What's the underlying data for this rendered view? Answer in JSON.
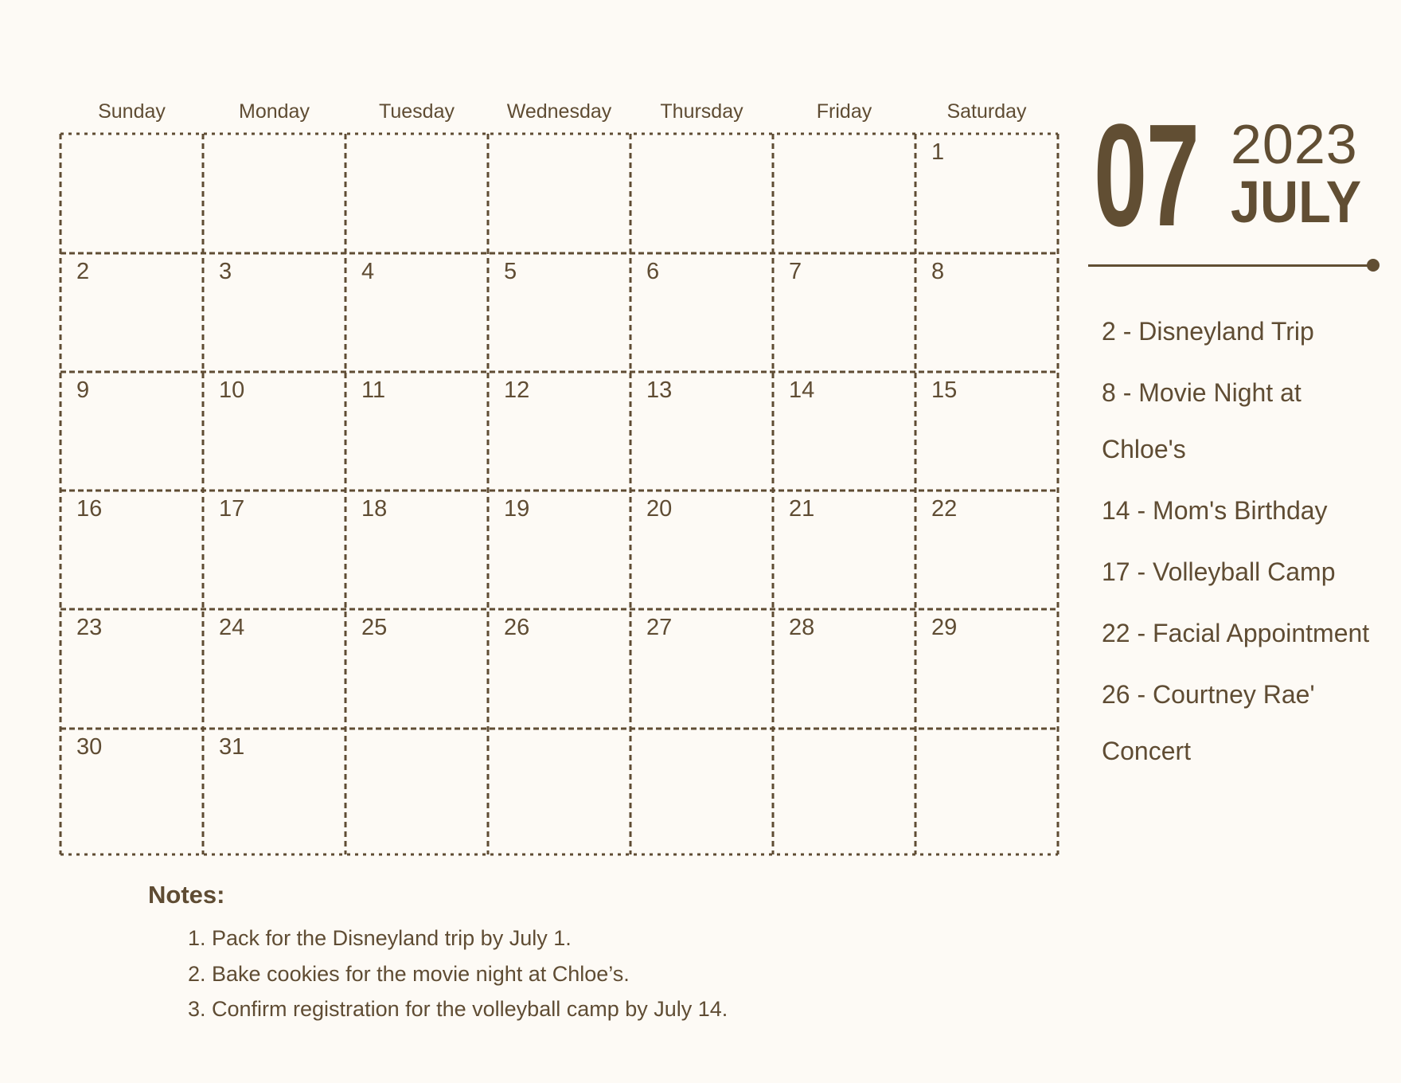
{
  "header": {
    "month_number": "07",
    "year": "2023",
    "month_name": "JULY"
  },
  "weekdays": [
    "Sunday",
    "Monday",
    "Tuesday",
    "Wednesday",
    "Thursday",
    "Friday",
    "Saturday"
  ],
  "weeks": [
    [
      "",
      "",
      "",
      "",
      "",
      "",
      "1"
    ],
    [
      "2",
      "3",
      "4",
      "5",
      "6",
      "7",
      "8"
    ],
    [
      "9",
      "10",
      "11",
      "12",
      "13",
      "14",
      "15"
    ],
    [
      "16",
      "17",
      "18",
      "19",
      "20",
      "21",
      "22"
    ],
    [
      "23",
      "24",
      "25",
      "26",
      "27",
      "28",
      "29"
    ],
    [
      "30",
      "31",
      "",
      "",
      "",
      "",
      ""
    ]
  ],
  "events": [
    "2 - Disneyland Trip",
    "8 - Movie Night at Chloe's",
    "14 - Mom's Birthday",
    "17 - Volleyball Camp",
    "22 - Facial Appointment",
    "26 - Courtney Rae' Concert"
  ],
  "notes": {
    "title": "Notes:",
    "items": [
      "1. Pack for the Disneyland trip by July 1.",
      "2. Bake cookies for the movie night at Chloe’s.",
      "3. Confirm registration for the volleyball camp by July 14."
    ]
  },
  "colors": {
    "text": "#5f4c33",
    "accent": "#614e33",
    "background": "#fdfaf5"
  }
}
